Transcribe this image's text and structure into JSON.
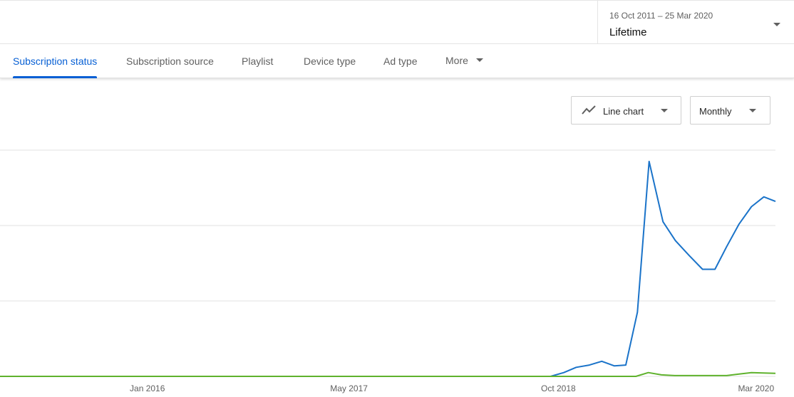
{
  "date_picker": {
    "range": "16 Oct 2011 – 25 Mar 2020",
    "period": "Lifetime"
  },
  "tabs": [
    {
      "label": "Subscription status",
      "active": true
    },
    {
      "label": "Subscription source",
      "active": false
    },
    {
      "label": "Playlist",
      "active": false
    },
    {
      "label": "Device type",
      "active": false
    },
    {
      "label": "Ad type",
      "active": false
    },
    {
      "label": "More",
      "active": false
    }
  ],
  "controls": {
    "chart_type": {
      "label": "Line chart",
      "icon": "line-chart-icon"
    },
    "interval": {
      "label": "Monthly"
    }
  },
  "colors": {
    "accent": "#065fd4",
    "series_blue": "#1a73c9",
    "series_green": "#5fb22d"
  },
  "chart_data": {
    "type": "line",
    "x_tick_labels": [
      "Jan 2016",
      "May 2017",
      "Oct 2018",
      "Mar 2020"
    ],
    "x_tick_positions": [
      0.19,
      0.45,
      0.72,
      0.975
    ],
    "y_gridlines": [
      0,
      1,
      2,
      3
    ],
    "ylim": [
      0,
      3
    ],
    "series": [
      {
        "color": "#1a73c9",
        "points": [
          [
            0.0,
            0
          ],
          [
            0.71,
            0
          ],
          [
            0.727,
            0.05
          ],
          [
            0.743,
            0.12
          ],
          [
            0.76,
            0.15
          ],
          [
            0.776,
            0.2
          ],
          [
            0.792,
            0.14
          ],
          [
            0.807,
            0.15
          ],
          [
            0.822,
            0.85
          ],
          [
            0.837,
            2.85
          ],
          [
            0.855,
            2.05
          ],
          [
            0.871,
            1.8
          ],
          [
            0.889,
            1.6
          ],
          [
            0.906,
            1.42
          ],
          [
            0.922,
            1.42
          ],
          [
            0.937,
            1.72
          ],
          [
            0.953,
            2.02
          ],
          [
            0.969,
            2.25
          ],
          [
            0.985,
            2.38
          ],
          [
            1.0,
            2.32
          ]
        ]
      },
      {
        "color": "#5fb22d",
        "points": [
          [
            0.0,
            0
          ],
          [
            0.82,
            0
          ],
          [
            0.836,
            0.05
          ],
          [
            0.853,
            0.02
          ],
          [
            0.87,
            0.01
          ],
          [
            0.937,
            0.01
          ],
          [
            0.953,
            0.03
          ],
          [
            0.969,
            0.05
          ],
          [
            1.0,
            0.04
          ]
        ]
      }
    ]
  }
}
